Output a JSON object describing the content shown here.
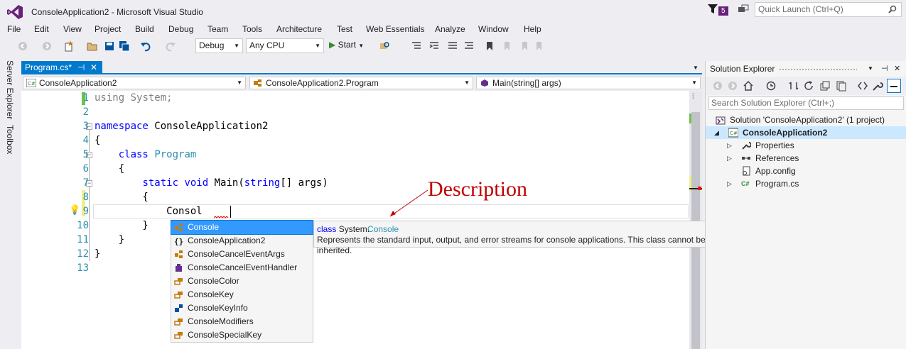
{
  "titlebar": {
    "title": "ConsoleApplication2 - Microsoft Visual Studio",
    "notification_count": "5",
    "quick_launch_placeholder": "Quick Launch (Ctrl+Q)"
  },
  "menu": [
    "File",
    "Edit",
    "View",
    "Project",
    "Build",
    "Debug",
    "Team",
    "Tools",
    "Architecture",
    "Test",
    "Web Essentials",
    "Analyze",
    "Window",
    "Help"
  ],
  "toolbar": {
    "config": "Debug",
    "platform": "Any CPU",
    "start_label": "Start"
  },
  "side_tabs": [
    "Server Explorer",
    "Toolbox"
  ],
  "document_tab": {
    "label": "Program.cs*",
    "pin": "⊣",
    "close": "✕"
  },
  "navbar": {
    "project": "ConsoleApplication2",
    "class": "ConsoleApplication2.Program",
    "member": "Main(string[] args)"
  },
  "editor": {
    "line_numbers": [
      "1",
      "2",
      "3",
      "4",
      "5",
      "6",
      "7",
      "8",
      "9",
      "10",
      "11",
      "12",
      "13"
    ],
    "lines": [
      {
        "parts": [
          [
            "kw-gray",
            "using"
          ],
          [
            "gray",
            " System;"
          ]
        ]
      },
      {
        "parts": []
      },
      {
        "parts": [
          [
            "kw",
            "namespace"
          ],
          [
            "plain",
            " ConsoleApplication2"
          ]
        ]
      },
      {
        "parts": [
          [
            "plain",
            "{"
          ]
        ]
      },
      {
        "parts": [
          [
            "plain",
            "    "
          ],
          [
            "kw",
            "class"
          ],
          [
            "plain",
            " "
          ],
          [
            "ty",
            "Program"
          ]
        ]
      },
      {
        "parts": [
          [
            "plain",
            "    {"
          ]
        ]
      },
      {
        "parts": [
          [
            "plain",
            "        "
          ],
          [
            "kw",
            "static"
          ],
          [
            "plain",
            " "
          ],
          [
            "kw",
            "void"
          ],
          [
            "plain",
            " Main("
          ],
          [
            "kw",
            "string"
          ],
          [
            "plain",
            "[] args)"
          ]
        ]
      },
      {
        "parts": [
          [
            "plain",
            "        {"
          ]
        ]
      },
      {
        "parts": [
          [
            "plain",
            "            Consol"
          ]
        ]
      },
      {
        "parts": [
          [
            "plain",
            "        }"
          ]
        ]
      },
      {
        "parts": [
          [
            "plain",
            "    }"
          ]
        ]
      },
      {
        "parts": [
          [
            "plain",
            "}"
          ]
        ]
      },
      {
        "parts": []
      }
    ]
  },
  "intellisense": {
    "items": [
      {
        "label": "Console",
        "icon": "class-icon",
        "selected": true
      },
      {
        "label": "ConsoleApplication2",
        "icon": "namespace-icon",
        "selected": false
      },
      {
        "label": "ConsoleCancelEventArgs",
        "icon": "class-icon",
        "selected": false
      },
      {
        "label": "ConsoleCancelEventHandler",
        "icon": "delegate-icon",
        "selected": false
      },
      {
        "label": "ConsoleColor",
        "icon": "enum-icon",
        "selected": false
      },
      {
        "label": "ConsoleKey",
        "icon": "enum-icon",
        "selected": false
      },
      {
        "label": "ConsoleKeyInfo",
        "icon": "struct-icon",
        "selected": false
      },
      {
        "label": "ConsoleModifiers",
        "icon": "enum-icon",
        "selected": false
      },
      {
        "label": "ConsoleSpecialKey",
        "icon": "enum-icon",
        "selected": false
      }
    ],
    "tooltip": {
      "keyword": "class",
      "namespace": "System.",
      "type": "Console",
      "description": "Represents the standard input, output, and error streams for console applications. This class cannot be inherited."
    }
  },
  "annotation": "Description",
  "solution_explorer": {
    "title": "Solution Explorer",
    "search_placeholder": "Search Solution Explorer (Ctrl+;)",
    "solution": "Solution 'ConsoleApplication2' (1 project)",
    "project": "ConsoleApplication2",
    "items": [
      "Properties",
      "References",
      "App.config",
      "Program.cs"
    ]
  },
  "colors": {
    "accent": "#007acc",
    "vs_purple": "#68217a",
    "selection": "#3399ff",
    "keyword": "#0000ff",
    "type": "#2b91af",
    "annotation_red": "#c00000"
  }
}
